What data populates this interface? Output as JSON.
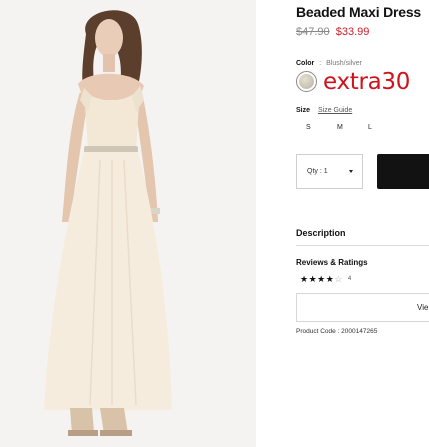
{
  "product": {
    "title": "Beaded Maxi Dress",
    "price_original": "$47.90",
    "price_sale": "$33.99",
    "color_label": "Color",
    "color_separator": ":",
    "color_value": "Blush/silver",
    "promo_text": "extra30",
    "size_label": "Size",
    "size_guide_label": "Size Guide",
    "sizes": [
      "S",
      "M",
      "L"
    ],
    "qty_label": "Qty : 1",
    "description_label": "Description",
    "reviews_label": "Reviews & Ratings",
    "rating": 4,
    "rating_max": 5,
    "review_count": "4",
    "view_button_label": "Vie",
    "product_code": "Product Code : 2000147265"
  },
  "icons": {
    "star": "star-icon",
    "dropdown": "chevron-down-icon",
    "swatch": "color-swatch"
  },
  "colors": {
    "sale_price": "#cc1f2b",
    "promo": "#d0121b",
    "button_dark": "#121212"
  }
}
